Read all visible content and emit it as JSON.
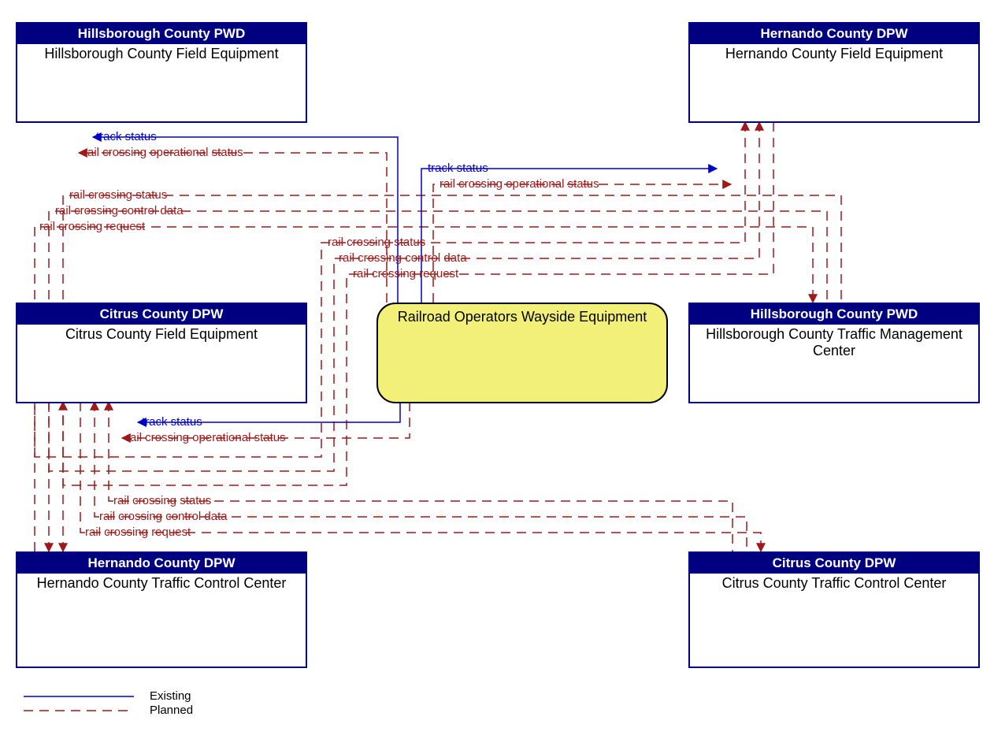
{
  "nodes": {
    "hillsborough_fe": {
      "header": "Hillsborough County PWD",
      "body": "Hillsborough County Field Equipment"
    },
    "hernando_fe": {
      "header": "Hernando County DPW",
      "body": "Hernando County Field Equipment"
    },
    "citrus_fe": {
      "header": "Citrus County DPW",
      "body": "Citrus County Field Equipment"
    },
    "hillsborough_tmc": {
      "header": "Hillsborough County PWD",
      "body": "Hillsborough County Traffic Management Center"
    },
    "hernando_tcc": {
      "header": "Hernando County DPW",
      "body": "Hernando County Traffic Control Center"
    },
    "citrus_tcc": {
      "header": "Citrus County DPW",
      "body": "Citrus County Traffic Control Center"
    },
    "center": {
      "body": "Railroad Operators Wayside Equipment"
    }
  },
  "flows": {
    "track_status": "track status",
    "rail_op_status": "rail crossing operational status",
    "rail_status": "rail crossing status",
    "rail_ctrl": "rail crossing control data",
    "rail_req": "rail crossing request"
  },
  "legend": {
    "existing": "Existing",
    "planned": "Planned"
  }
}
